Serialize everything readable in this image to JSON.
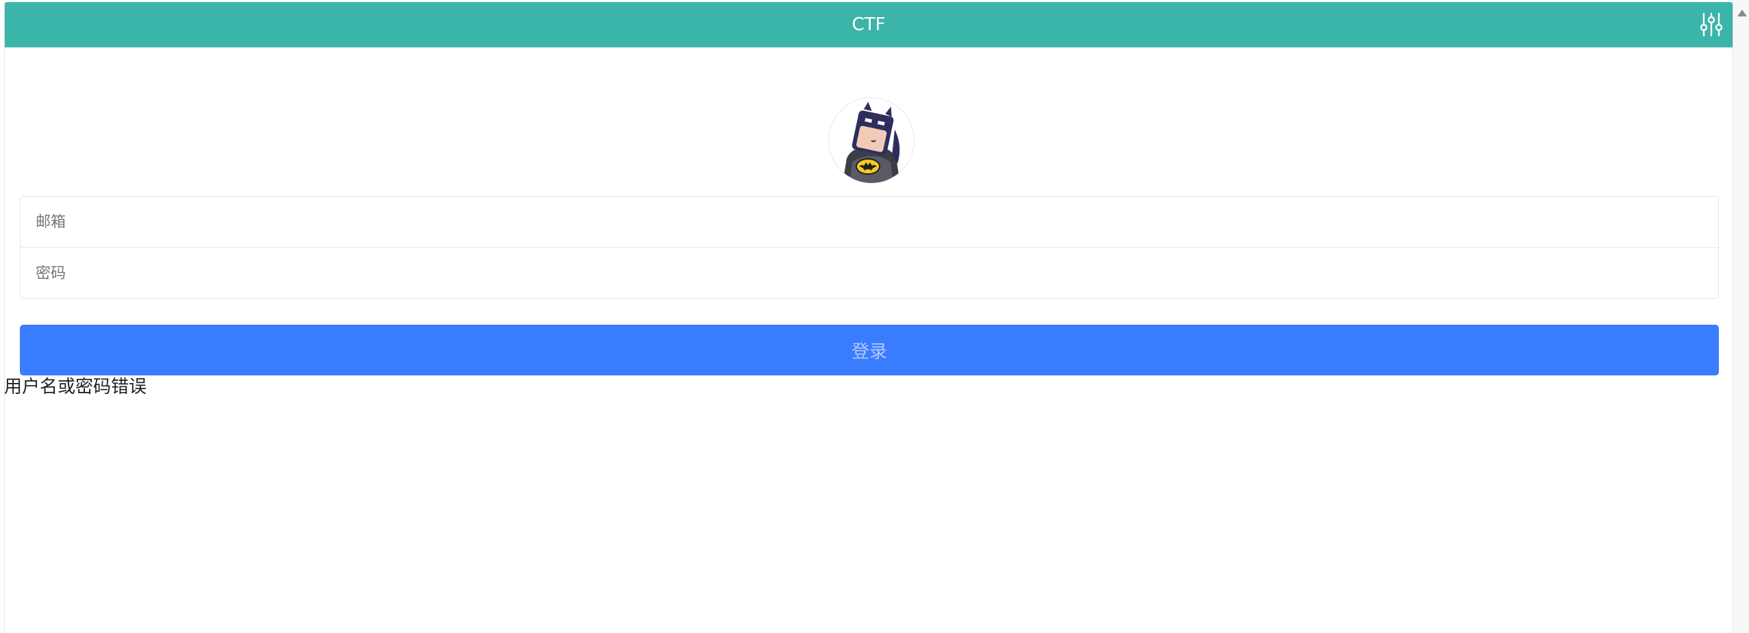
{
  "header": {
    "title": "CTF",
    "settings_icon": "sliders-icon"
  },
  "avatar": {
    "icon": "batman-avatar"
  },
  "login_form": {
    "email_placeholder": "邮箱",
    "password_placeholder": "密码",
    "submit_label": "登录"
  },
  "message": {
    "error": "用户名或密码错误"
  },
  "colors": {
    "header_bg": "#3bb5a9",
    "button_bg": "#3a7cfe",
    "button_text": "#b3cbff"
  }
}
